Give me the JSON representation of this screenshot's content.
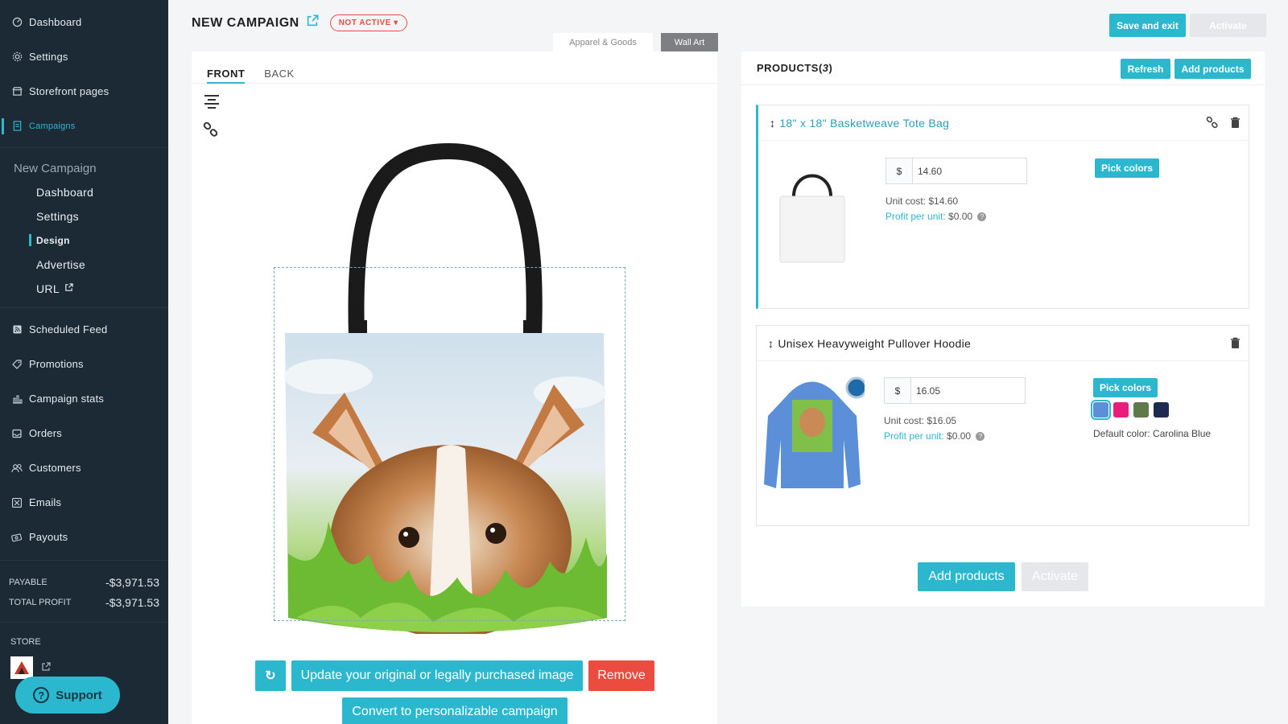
{
  "sidebar": {
    "nav_top": [
      {
        "label": "Dashboard",
        "icon": "dashboard-icon"
      },
      {
        "label": "Settings",
        "icon": "gear-icon"
      },
      {
        "label": "Storefront pages",
        "icon": "storefront-icon"
      },
      {
        "label": "Campaigns",
        "icon": "campaigns-icon",
        "active": true
      }
    ],
    "campaign_sub": {
      "title": "New Campaign",
      "items": [
        {
          "label": "Dashboard"
        },
        {
          "label": "Settings"
        },
        {
          "label": "Design",
          "active": true
        },
        {
          "label": "Advertise"
        },
        {
          "label": "URL"
        }
      ]
    },
    "nav_bottom": [
      {
        "label": "Scheduled Feed",
        "icon": "rss-icon"
      },
      {
        "label": "Promotions",
        "icon": "tag-icon"
      },
      {
        "label": "Campaign stats",
        "icon": "stats-icon"
      },
      {
        "label": "Orders",
        "icon": "inbox-icon"
      },
      {
        "label": "Customers",
        "icon": "users-icon"
      },
      {
        "label": "Emails",
        "icon": "email-icon"
      },
      {
        "label": "Payouts",
        "icon": "money-icon"
      }
    ],
    "payable_label": "PAYABLE",
    "payable_value": "-$3,971.53",
    "total_profit_label": "TOTAL PROFIT",
    "total_profit_value": "-$3,971.53",
    "store_label": "STORE",
    "support_label": "Support"
  },
  "header": {
    "title": "NEW CAMPAIGN",
    "status": "NOT ACTIVE",
    "save_exit": "Save and exit",
    "activate": "Activate"
  },
  "editor": {
    "category_tabs": [
      "Apparel & Goods",
      "Wall Art"
    ],
    "side_tabs": [
      "FRONT",
      "BACK"
    ],
    "update_image": "Update your original or legally purchased image",
    "remove": "Remove",
    "convert": "Convert to personalizable campaign"
  },
  "products": {
    "title": "PRODUCTS",
    "count": "3",
    "refresh": "Refresh",
    "add_products": "Add products",
    "items": [
      {
        "name": "18\" x 18\" Basketweave Tote Bag",
        "currency": "$",
        "price": "14.60",
        "unit_cost": "Unit cost: $14.60",
        "profit_label": "Profit per unit:",
        "profit_value": "$0.00",
        "pick_colors": "Pick colors"
      },
      {
        "name": "Unisex Heavyweight Pullover Hoodie",
        "currency": "$",
        "price": "16.05",
        "unit_cost": "Unit cost: $16.05",
        "profit_label": "Profit per unit:",
        "profit_value": "$0.00",
        "pick_colors": "Pick colors",
        "swatches": [
          "#5b8fd8",
          "#e91e7a",
          "#5f7a4a",
          "#1f2a50"
        ],
        "default_color": "Default color: Carolina Blue"
      }
    ],
    "add_products_bottom": "Add products",
    "activate_bottom": "Activate"
  },
  "colors": {
    "accent": "#2bb8cf",
    "sidebar_bg": "#1c2a36",
    "danger": "#ec4b3f"
  }
}
